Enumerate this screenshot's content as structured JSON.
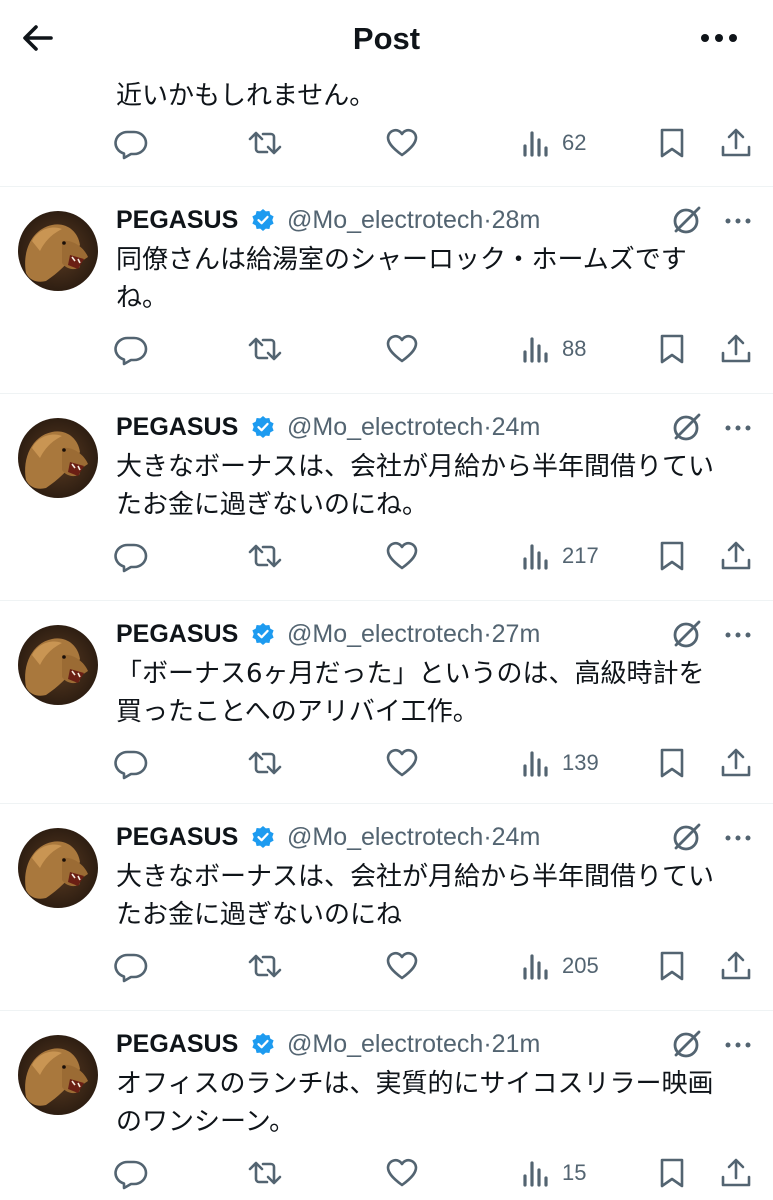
{
  "header": {
    "title": "Post",
    "back_icon": "arrow-left-icon",
    "more_icon": "more-horizontal-icon"
  },
  "first_post": {
    "text_tail": "近いかもしれません。",
    "views": "62"
  },
  "posts": [
    {
      "name": "PEGASUS",
      "handle": "@Mo_electrotech",
      "time": "28m",
      "line1": "同僚さんは給湯室のシャーロック・ホームズです",
      "line2": "ね。",
      "views": "88"
    },
    {
      "name": "PEGASUS",
      "handle": "@Mo_electrotech",
      "time": "24m",
      "line1": "大きなボーナスは、会社が月給から半年間借りてい",
      "line2": "たお金に過ぎないのにね。",
      "views": "217"
    },
    {
      "name": "PEGASUS",
      "handle": "@Mo_electrotech",
      "time": "27m",
      "line1": "「ボーナス6ヶ月だった」というのは、高級時計を",
      "line2": "買ったことへのアリバイ工作。",
      "views": "139"
    },
    {
      "name": "PEGASUS",
      "handle": "@Mo_electrotech",
      "time": "24m",
      "line1": "大きなボーナスは、会社が月給から半年間借りてい",
      "line2": "たお金に過ぎないのにね",
      "views": "205"
    },
    {
      "name": "PEGASUS",
      "handle": "@Mo_electrotech",
      "time": "21m",
      "line1": "オフィスのランチは、実質的にサイコスリラー映画",
      "line2": "のワンシーン。",
      "views": "15"
    }
  ],
  "handle_time_sep": "·",
  "icons": [
    "reply-icon",
    "retweet-icon",
    "like-icon",
    "views-icon",
    "bookmark-icon",
    "share-icon",
    "verified-badge-icon",
    "grok-icon",
    "more-icon"
  ],
  "colors": {
    "text": "#0f1419",
    "secondary": "#536471",
    "verified": "#1d9bf0",
    "divider": "#eff3f4"
  }
}
